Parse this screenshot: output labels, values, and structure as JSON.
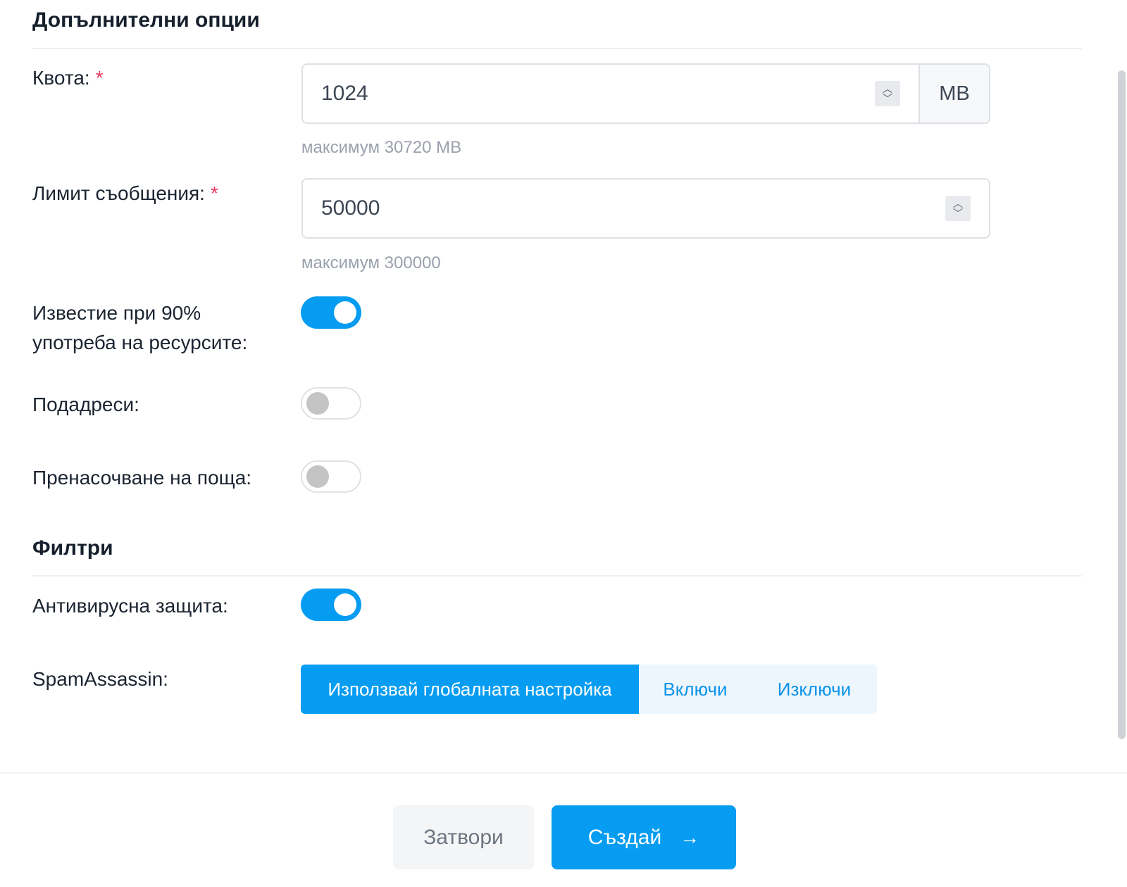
{
  "additional_options": {
    "title": "Допълнителни опции",
    "quota": {
      "label": "Квота:",
      "required_mark": "*",
      "value": "1024",
      "unit": "MB",
      "hint": "максимум 30720 MB"
    },
    "message_limit": {
      "label": "Лимит съобщения:",
      "required_mark": "*",
      "value": "50000",
      "hint": "максимум 300000"
    },
    "usage_notice": {
      "label_line1": "Известие при 90%",
      "label_line2": "употреба на ресурсите:",
      "enabled": true
    },
    "subaddresses": {
      "label": "Подадреси:",
      "enabled": false
    },
    "mail_forwarding": {
      "label": "Пренасочване на поща:",
      "enabled": false
    }
  },
  "filters": {
    "title": "Филтри",
    "antivirus": {
      "label": "Антивирусна защита:",
      "enabled": true
    },
    "spamassassin": {
      "label": "SpamAssassin:",
      "options": [
        "Използвай глобалната настройка",
        "Включи",
        "Изключи"
      ],
      "selected": "Използвай глобалната настройка"
    }
  },
  "footer": {
    "close_label": "Затвори",
    "create_label": "Създай",
    "create_icon": "arrow-right-icon"
  },
  "colors": {
    "accent": "#069cf1",
    "required": "#e8365d"
  }
}
